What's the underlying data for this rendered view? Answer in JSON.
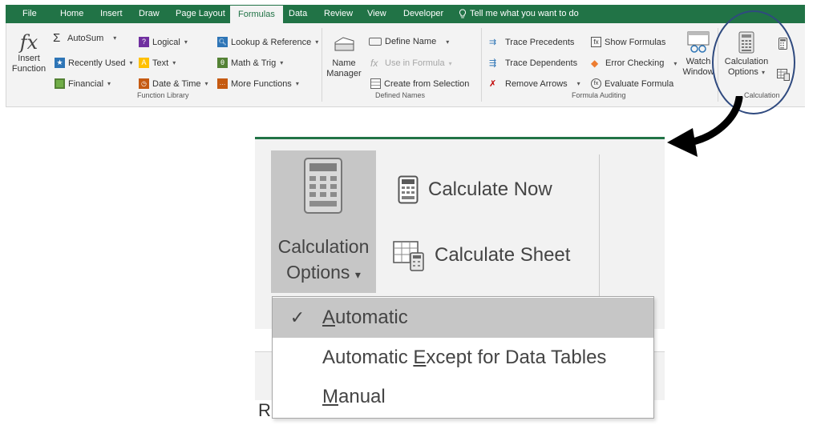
{
  "tabs": [
    "File",
    "Home",
    "Insert",
    "Draw",
    "Page Layout",
    "Formulas",
    "Data",
    "Review",
    "View",
    "Developer"
  ],
  "active_tab": "Formulas",
  "tell_me": "Tell me what you want to do",
  "function_library": {
    "insert_function": [
      "Insert",
      "Function"
    ],
    "autosum": "AutoSum",
    "recently_used": "Recently Used",
    "financial": "Financial",
    "logical": "Logical",
    "text": "Text",
    "date_time": "Date & Time",
    "lookup_reference": "Lookup & Reference",
    "math_trig": "Math & Trig",
    "more_functions": "More Functions",
    "label": "Function Library"
  },
  "defined_names": {
    "name_manager": [
      "Name",
      "Manager"
    ],
    "define_name": "Define Name",
    "use_in_formula": "Use in Formula",
    "create_from_selection": "Create from Selection",
    "label": "Defined Names"
  },
  "formula_auditing": {
    "trace_precedents": "Trace Precedents",
    "trace_dependents": "Trace Dependents",
    "remove_arrows": "Remove Arrows",
    "show_formulas": "Show Formulas",
    "error_checking": "Error Checking",
    "evaluate_formula": "Evaluate Formula",
    "watch_window": [
      "Watch",
      "Window"
    ],
    "label": "Formula Auditing"
  },
  "calculation": {
    "options": [
      "Calculation",
      "Options"
    ],
    "label": "Calculation"
  },
  "zoom": {
    "calc_options": [
      "Calculation",
      "Options"
    ],
    "calculate_now": "Calculate Now",
    "calculate_sheet": "Calculate Sheet",
    "menu": [
      {
        "before": "",
        "mnemonic": "A",
        "after": "utomatic",
        "checked": true
      },
      {
        "before": "Automatic ",
        "mnemonic": "E",
        "after": "xcept for Data Tables",
        "checked": false
      },
      {
        "before": "",
        "mnemonic": "M",
        "after": "anual",
        "checked": false
      }
    ],
    "check_mark": "✓",
    "partial_cell_text": "R"
  },
  "colors": {
    "excel_green": "#217346",
    "highlight_circle": "#2f4a7f"
  }
}
